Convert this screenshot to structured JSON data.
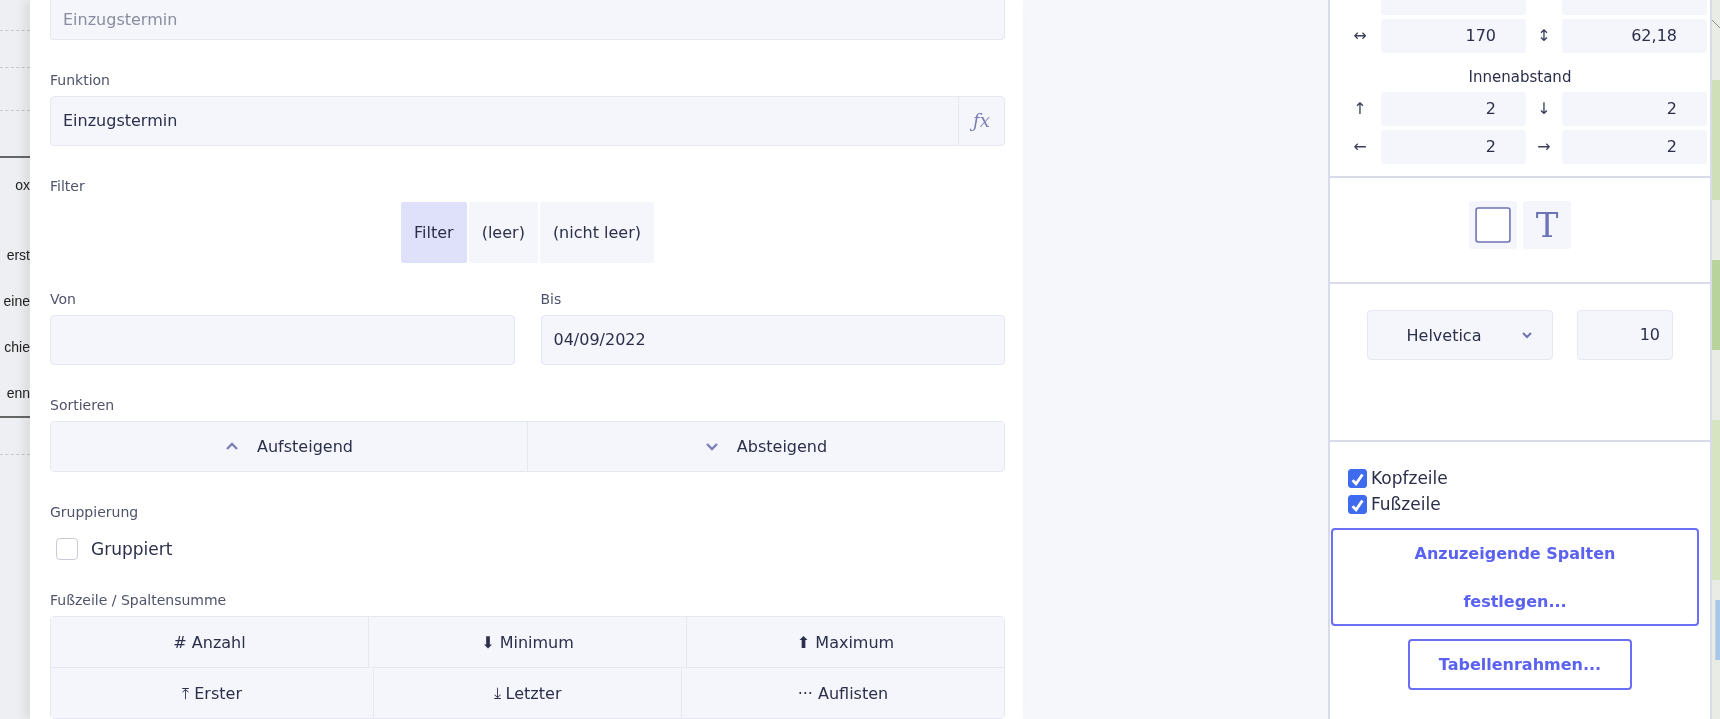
{
  "background_fragments": [
    "ox",
    "erst",
    "eine",
    "chie",
    "enn"
  ],
  "column_editor": {
    "title_field": {
      "placeholder": "Einzugstermin"
    },
    "function": {
      "label": "Funktion",
      "value": "Einzugstermin",
      "button": "ƒx"
    },
    "filter": {
      "label": "Filter",
      "options": [
        {
          "label": "Filter",
          "selected": true
        },
        {
          "label": "(leer)",
          "selected": false
        },
        {
          "label": "(nicht leer)",
          "selected": false
        }
      ]
    },
    "range": [
      {
        "label": "Von"
      },
      {
        "label": "Bis",
        "value": "04/09/2022"
      }
    ],
    "sort": {
      "label": "Sortieren",
      "options": [
        {
          "label": "Aufsteigend",
          "kind": "up"
        },
        {
          "label": "Absteigend",
          "kind": "down"
        }
      ]
    },
    "grouping": {
      "label": "Gruppierung",
      "checkbox": {
        "label": "Gruppiert",
        "checked": false
      }
    },
    "footer": {
      "label": "Fußzeile / Spaltensumme",
      "rows": [
        [
          "# Anzahl",
          "⬇ Minimum",
          "⬆ Maximum"
        ],
        [
          "⤒ Erster",
          "⤓ Letzter",
          "··· Auflisten"
        ]
      ]
    }
  },
  "properties_panel": {
    "position": [
      {
        "label": "↔",
        "value": "170"
      },
      {
        "label": "↕",
        "value": "62,18"
      }
    ],
    "padding_title": "Innenabstand",
    "padding": [
      {
        "label": "↑",
        "value": "2"
      },
      {
        "label": "↓",
        "value": "2"
      },
      {
        "label": "←",
        "value": "2"
      },
      {
        "label": "→",
        "value": "2"
      }
    ],
    "style_buttons": [
      {
        "kind": "box"
      },
      {
        "kind": "text",
        "label": "T"
      }
    ],
    "font": {
      "family": "Helvetica",
      "size": "10"
    },
    "checkboxes": [
      {
        "label": "Kopfzeile",
        "checked": true
      },
      {
        "label": "Fußzeile",
        "checked": true
      }
    ],
    "buttons": [
      "Anzuzeigende Spalten festlegen...",
      "Tabellenrahmen..."
    ]
  }
}
